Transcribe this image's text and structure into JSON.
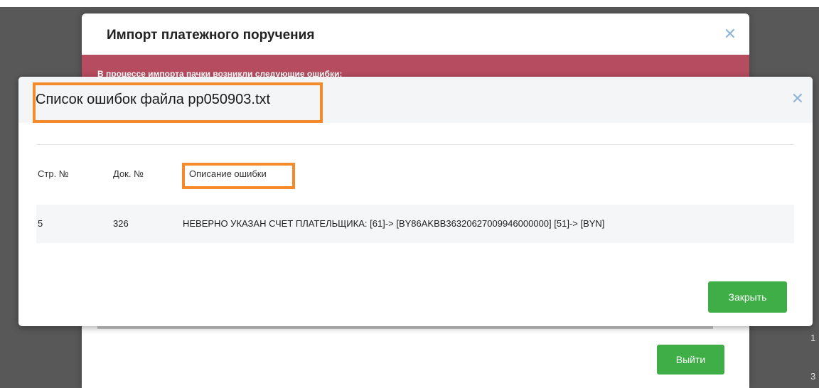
{
  "background_dialog": {
    "title": "Импорт платежного поручения",
    "close_glyph": "✕",
    "alert_text": "В процессе импорта пачки возникли следующие ошибки:",
    "exit_label": "Выйти",
    "edge_numbers": [
      "1",
      "3"
    ]
  },
  "error_dialog": {
    "title": "Список ошибок файла pp050903.txt",
    "close_glyph": "✕",
    "columns": [
      "Стр. №",
      "Док. №",
      "Описание ошибки"
    ],
    "rows": [
      {
        "line": "5",
        "doc": "326",
        "description": "НЕВЕРНО УКАЗАН СЧЕТ ПЛАТЕЛЬЩИКА: [61]-> [BY86AKBB36320627009946000000] [51]-> [BYN]"
      }
    ],
    "close_label": "Закрыть"
  },
  "colors": {
    "accent_green": "#3fae46",
    "alert_red": "#b64c60",
    "highlight_orange": "#f58a2a",
    "close_icon_blue": "#8fb6d9"
  }
}
